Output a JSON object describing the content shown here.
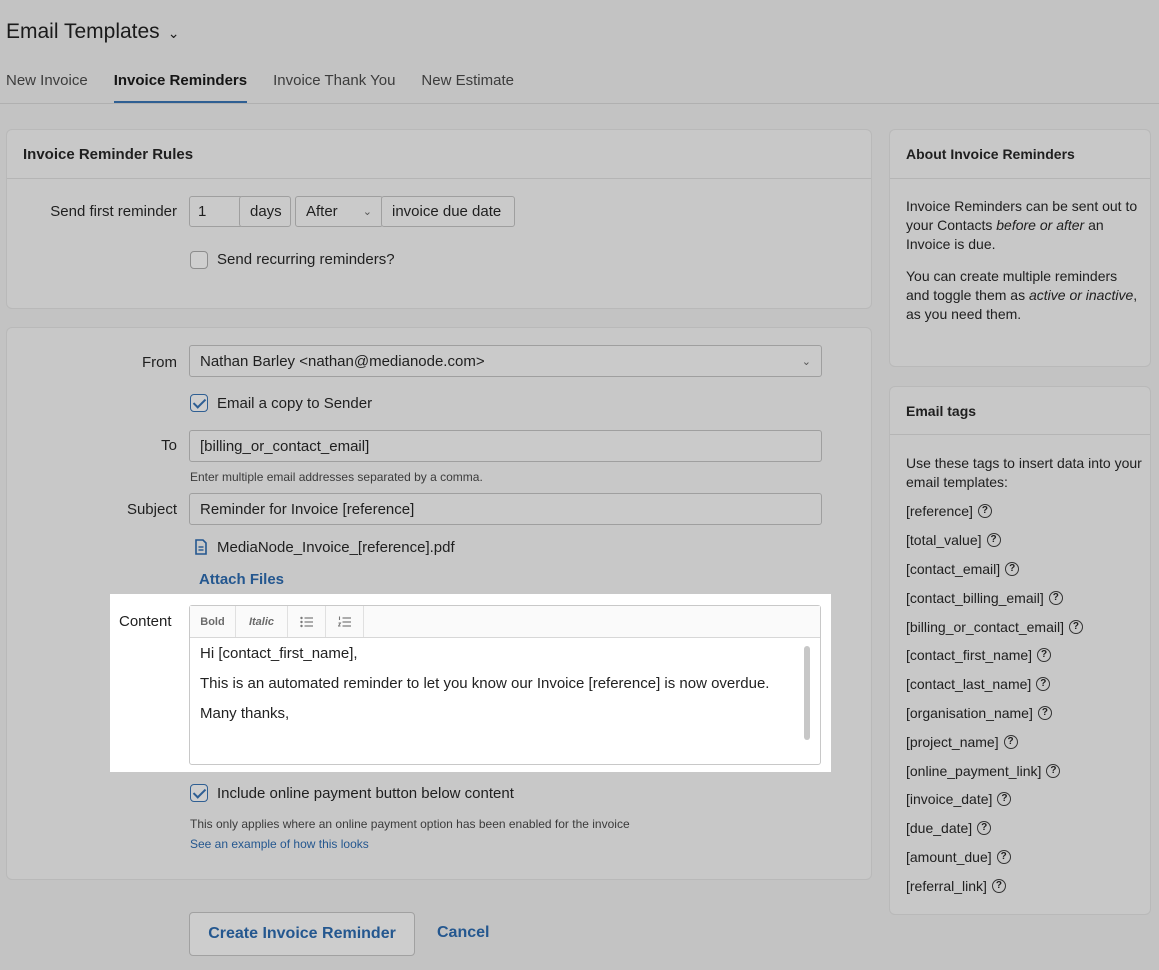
{
  "header": {
    "title": "Email Templates",
    "tabs": [
      {
        "label": "New Invoice",
        "active": false
      },
      {
        "label": "Invoice Reminders",
        "active": true
      },
      {
        "label": "Invoice Thank You",
        "active": false
      },
      {
        "label": "New Estimate",
        "active": false
      }
    ]
  },
  "rules": {
    "title": "Invoice Reminder Rules",
    "send_first_label": "Send first reminder",
    "days_value": "1",
    "days_unit": "days",
    "timing_value": "After",
    "timing_suffix": "invoice due date",
    "recurring_label": "Send recurring reminders?"
  },
  "form": {
    "from_label": "From",
    "from_value": "Nathan Barley <nathan@medianode.com>",
    "copy_sender_label": "Email a copy to Sender",
    "to_label": "To",
    "to_value": "[billing_or_contact_email]",
    "to_hint": "Enter multiple email addresses separated by a comma.",
    "subject_label": "Subject",
    "subject_value": "Reminder for Invoice [reference]",
    "attachment_name": "MediaNode_Invoice_[reference].pdf",
    "attach_files_label": "Attach Files",
    "content_label": "Content",
    "toolbar": {
      "bold": "Bold",
      "italic": "Italic"
    },
    "content_lines": [
      "Hi [contact_first_name],",
      "This is an automated reminder to let you know our Invoice [reference] is now overdue.",
      "Many thanks,"
    ],
    "payment_button_label": "Include online payment button below content",
    "payment_hint": "This only applies where an online payment option has been enabled for the invoice",
    "example_link": "See an example of how this looks"
  },
  "actions": {
    "create_label": "Create Invoice Reminder",
    "cancel_label": "Cancel"
  },
  "about": {
    "title": "About Invoice Reminders",
    "p1_start": "Invoice Reminders can be sent out to your Contacts ",
    "p1_em": "before or after",
    "p1_end": " an Invoice is due.",
    "p2_start": "You can create multiple reminders and toggle them as ",
    "p2_em": "active or inactive",
    "p2_end": ", as you need them."
  },
  "tags": {
    "title": "Email tags",
    "intro": "Use these tags to insert data into your email templates:",
    "items": [
      "[reference]",
      "[total_value]",
      "[contact_email]",
      "[contact_billing_email]",
      "[billing_or_contact_email]",
      "[contact_first_name]",
      "[contact_last_name]",
      "[organisation_name]",
      "[project_name]",
      "[online_payment_link]",
      "[invoice_date]",
      "[due_date]",
      "[amount_due]",
      "[referral_link]"
    ]
  },
  "colors": {
    "background": "#c3c3c3",
    "accent": "#24578f",
    "editor_background": "#ffffff"
  }
}
